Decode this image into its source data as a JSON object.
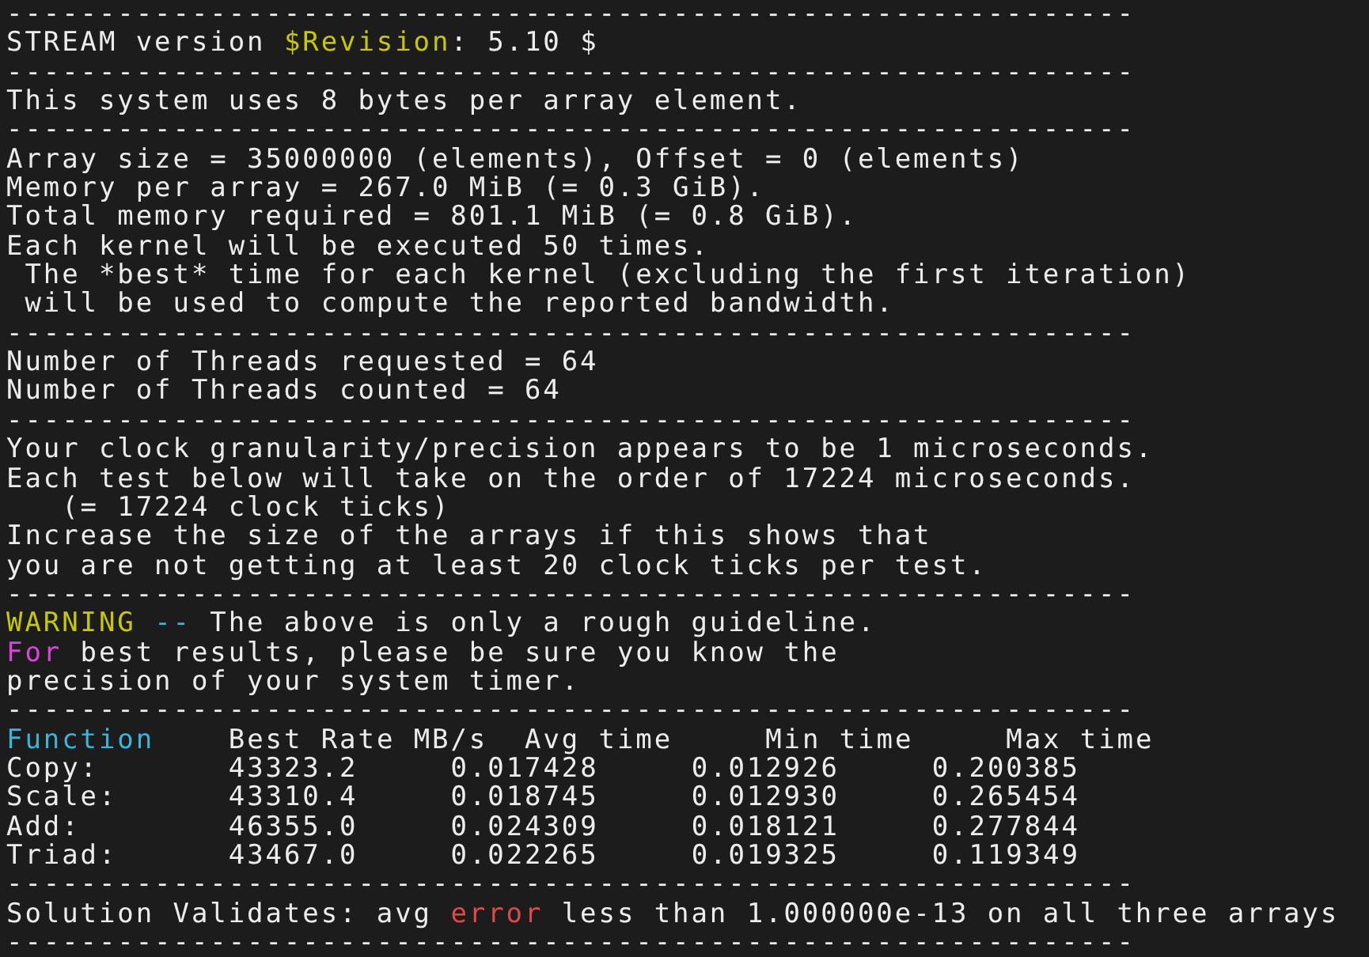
{
  "terminal": {
    "lines": [
      {
        "kind": "rule",
        "text": "-------------------------------------------------------------"
      },
      {
        "kind": "text",
        "segments": [
          {
            "text": "STREAM version "
          },
          {
            "text": "$Revision",
            "color": "#c8c800"
          },
          {
            "text": ": 5.10 $"
          }
        ]
      },
      {
        "kind": "rule",
        "text": "-------------------------------------------------------------"
      },
      {
        "kind": "text",
        "segments": [
          {
            "text": "This system uses 8 bytes per array element."
          }
        ]
      },
      {
        "kind": "rule",
        "text": "-------------------------------------------------------------"
      },
      {
        "kind": "text",
        "segments": [
          {
            "text": "Array size = 35000000 (elements), Offset = 0 (elements)"
          }
        ]
      },
      {
        "kind": "text",
        "segments": [
          {
            "text": "Memory per array = 267.0 MiB (= 0.3 GiB)."
          }
        ]
      },
      {
        "kind": "text",
        "segments": [
          {
            "text": "Total memory required = 801.1 MiB (= 0.8 GiB)."
          }
        ]
      },
      {
        "kind": "text",
        "segments": [
          {
            "text": "Each kernel will be executed 50 times."
          }
        ]
      },
      {
        "kind": "text",
        "segments": [
          {
            "text": " The *best* time for each kernel (excluding the first iteration)"
          }
        ]
      },
      {
        "kind": "text",
        "segments": [
          {
            "text": " will be used to compute the reported bandwidth."
          }
        ]
      },
      {
        "kind": "rule",
        "text": "-------------------------------------------------------------"
      },
      {
        "kind": "text",
        "segments": [
          {
            "text": "Number of Threads requested = 64"
          }
        ]
      },
      {
        "kind": "text",
        "segments": [
          {
            "text": "Number of Threads counted = 64"
          }
        ]
      },
      {
        "kind": "rule",
        "text": "-------------------------------------------------------------"
      },
      {
        "kind": "text",
        "segments": [
          {
            "text": "Your clock granularity/precision appears to be 1 microseconds."
          }
        ]
      },
      {
        "kind": "text",
        "segments": [
          {
            "text": "Each test below will take on the order of 17224 microseconds."
          }
        ]
      },
      {
        "kind": "text",
        "segments": [
          {
            "text": "   (= 17224 clock ticks)"
          }
        ]
      },
      {
        "kind": "text",
        "segments": [
          {
            "text": "Increase the size of the arrays if this shows that"
          }
        ]
      },
      {
        "kind": "text",
        "segments": [
          {
            "text": "you are not getting at least 20 clock ticks per test."
          }
        ]
      },
      {
        "kind": "rule",
        "text": "-------------------------------------------------------------"
      },
      {
        "kind": "text",
        "segments": [
          {
            "text": "WARNING",
            "color": "#c8c800"
          },
          {
            "text": " -- ",
            "color": "#3ab4d8"
          },
          {
            "text": "The above is only a rough guideline."
          }
        ]
      },
      {
        "kind": "text",
        "segments": [
          {
            "text": "For",
            "color": "#e040e0"
          },
          {
            "text": " best results, please be sure you know the"
          }
        ]
      },
      {
        "kind": "text",
        "segments": [
          {
            "text": "precision of your system timer."
          }
        ]
      },
      {
        "kind": "rule",
        "text": "-------------------------------------------------------------"
      },
      {
        "kind": "table",
        "columns": [
          {
            "label": "Function",
            "color": "#3ab4d8"
          },
          {
            "label": "Best Rate MB/s"
          },
          {
            "label": "Avg time"
          },
          {
            "label": "Min time"
          },
          {
            "label": "Max time"
          }
        ],
        "rows": [
          [
            "Copy:",
            "43323.2",
            "0.017428",
            "0.012926",
            "0.200385"
          ],
          [
            "Scale:",
            "43310.4",
            "0.018745",
            "0.012930",
            "0.265454"
          ],
          [
            "Add:",
            "46355.0",
            "0.024309",
            "0.018121",
            "0.277844"
          ],
          [
            "Triad:",
            "43467.0",
            "0.022265",
            "0.019325",
            "0.119349"
          ]
        ]
      },
      {
        "kind": "rule",
        "text": "-------------------------------------------------------------"
      },
      {
        "kind": "text",
        "segments": [
          {
            "text": "Solution Validates: avg "
          },
          {
            "text": "error",
            "color": "#e04848"
          },
          {
            "text": " less than 1.000000e-13 on all three arrays"
          }
        ]
      },
      {
        "kind": "rule",
        "text": "-------------------------------------------------------------"
      }
    ]
  }
}
